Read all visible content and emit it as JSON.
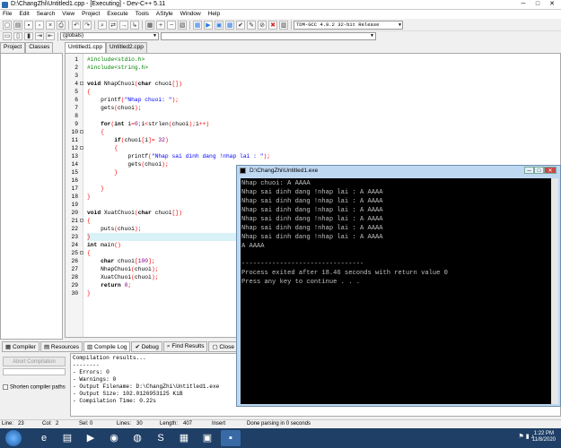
{
  "window": {
    "title": "D:\\ChangZhi\\Untitled1.cpp - [Executing] - Dev-C++ 5.11"
  },
  "menu": [
    "File",
    "Edit",
    "Search",
    "View",
    "Project",
    "Execute",
    "Tools",
    "AStyle",
    "Window",
    "Help"
  ],
  "toolbar": {
    "compiler": "TDM-GCC 4.9.2 32-bit Release",
    "scope": "(globals)"
  },
  "left_tabs": [
    "Project",
    "Classes"
  ],
  "editor_tabs": [
    "Untitled1.cpp",
    "Untitled2.cpp"
  ],
  "code_lines": [
    "#include<stdio.h>",
    "#include<string.h>",
    "",
    "void NhapChuoi(char chuoi[])",
    "{",
    "    printf(\"Nhap chuoi: \");",
    "    gets(chuoi);",
    "",
    "    for(int i=0;i<strlen(chuoi);i++)",
    "    {",
    "        if(chuoi[i]= 32)",
    "        {",
    "            printf(\"Nhap sai dinh dang !nhap lai : \");",
    "            gets(chuoi);",
    "        }",
    "",
    "    }",
    "}",
    "",
    "void XuatChuoi(char chuoi[])",
    "{",
    "    puts(chuoi);",
    "}",
    "int main()",
    "{",
    "    char chuoi[100];",
    "    NhapChuoi(chuoi);",
    "    XuatChuoi(chuoi);",
    "    return 0;",
    "}"
  ],
  "bottom_tabs": [
    "Compiler",
    "Resources",
    "Compile Log",
    "Debug",
    "Find Results",
    "Close"
  ],
  "compile": {
    "abort_label": "Abort Compilation",
    "shorten_label": "Shorten compiler paths",
    "log": "Compilation results...\n--------\n- Errors: 0\n- Warnings: 0\n- Output Filename: D:\\ChangZhi\\Untitled1.exe\n- Output Size: 102.0126953125 KiB\n- Compilation Time: 0.22s"
  },
  "status": {
    "line_label": "Line:",
    "line": "23",
    "col_label": "Col:",
    "col": "2",
    "sel_label": "Sel:",
    "sel": "0",
    "lines_label": "Lines:",
    "lines": "30",
    "length_label": "Length:",
    "length": "407",
    "mode": "Insert",
    "message": "Done parsing in 0 seconds"
  },
  "console": {
    "title": "D:\\ChangZhi\\Untitled1.exe",
    "output": "Nhap chuoi: A AAAA\nNhap sai dinh dang !nhap lai : A AAAA\nNhap sai dinh dang !nhap lai : A AAAA\nNhap sai dinh dang !nhap lai : A AAAA\nNhap sai dinh dang !nhap lai : A AAAA\nNhap sai dinh dang !nhap lai : A AAAA\nNhap sai dinh dang !nhap lai : A AAAA\nA AAAA\n\n--------------------------------\nProcess exited after 18.46 seconds with return value 0\nPress any key to continue . . ."
  },
  "taskbar": {
    "time": "1:22 PM",
    "date": "11/8/2020"
  }
}
